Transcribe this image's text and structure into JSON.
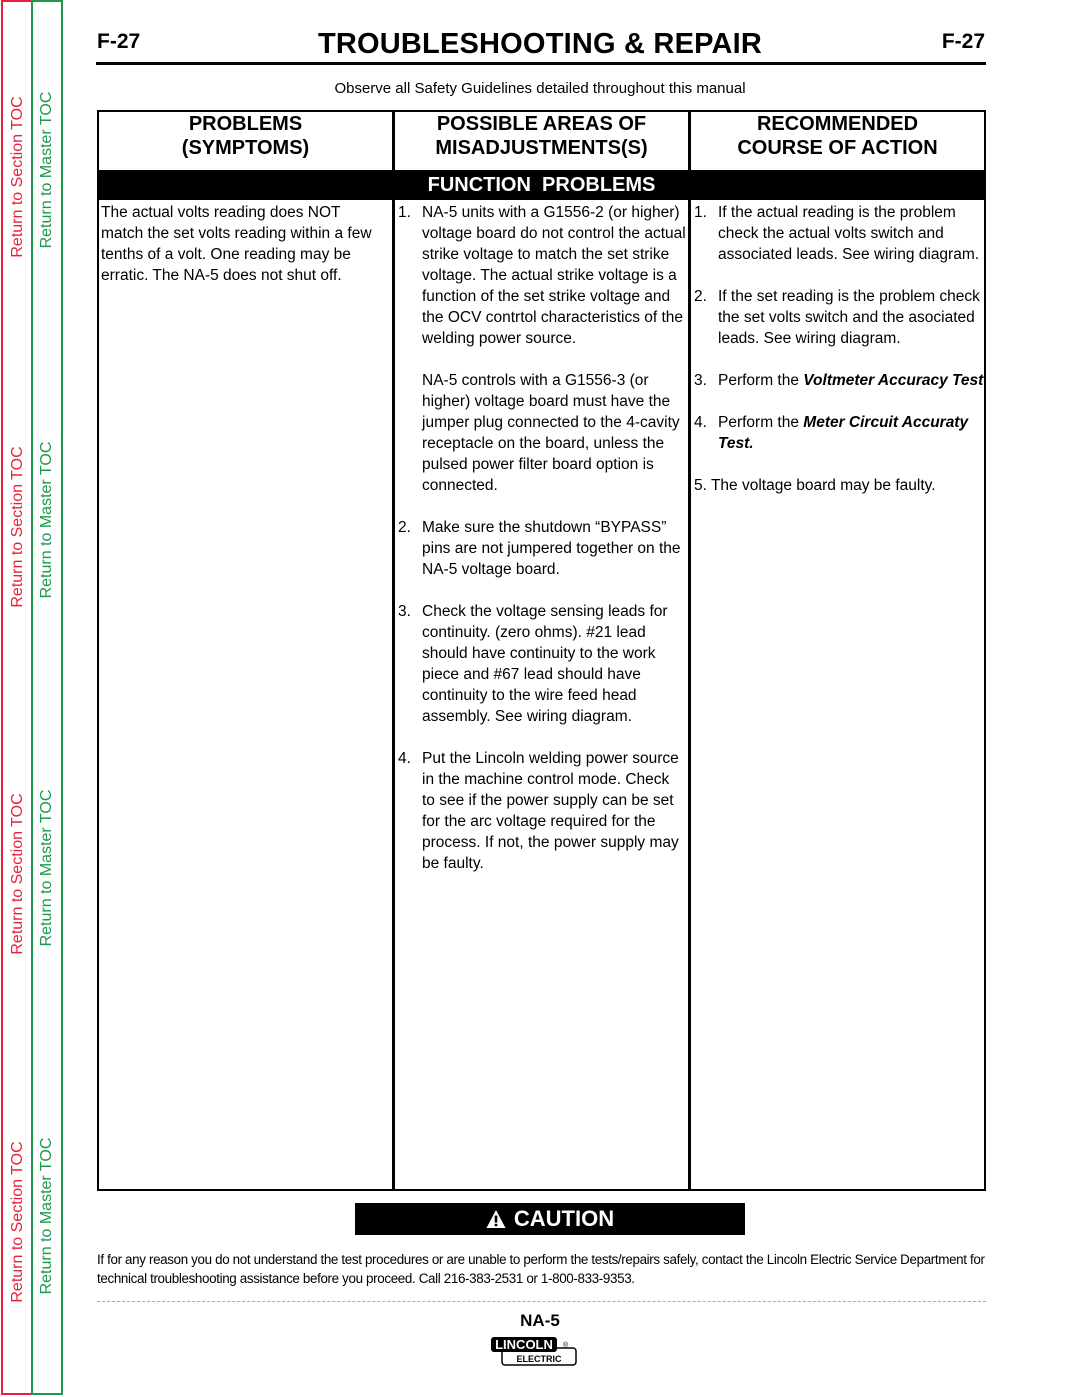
{
  "sidebar": {
    "section_toc_label": "Return to Section TOC",
    "master_toc_label": "Return to Master TOC",
    "section_color": "#e8213a",
    "master_color": "#1b9a4b"
  },
  "header": {
    "page_number": "F-27",
    "title": "TROUBLESHOOTING & REPAIR",
    "safety_note": "Observe all Safety Guidelines detailed throughout this manual"
  },
  "table": {
    "columns": [
      {
        "line1": "PROBLEMS",
        "line2": "(SYMPTOMS)"
      },
      {
        "line1": "POSSIBLE AREAS OF",
        "line2": "MISADJUSTMENTS(S)"
      },
      {
        "line1": "RECOMMENDED",
        "line2": "COURSE OF ACTION"
      }
    ],
    "section_band": "FUNCTION  PROBLEMS",
    "symptom": "The actual volts reading does NOT match the set volts reading within a few tenths of a volt.  One reading may be erratic.  The NA-5 does not shut off.",
    "misadjustments": [
      {
        "num": "1.",
        "text": "NA-5 units with a G1556-2 (or higher) voltage board do not control the actual strike voltage to match the set strike voltage.  The actual strike voltage is a function of the set strike voltage and the OCV contrtol characteristics of the welding power source.",
        "extra": "NA-5 controls with a G1556-3 (or higher) voltage board must have the jumper plug connected to the 4-cavity receptacle on the board, unless the pulsed power filter board option is connected."
      },
      {
        "num": "2.",
        "text": "Make sure the shutdown “BYPASS” pins are not jumpered together on the NA-5 voltage board."
      },
      {
        "num": "3.",
        "text": "Check the voltage sensing leads for continuity. (zero ohms).   #21 lead should have continuity to the work piece and #67 lead should have continuity to the wire feed head assembly.  See wiring diagram."
      },
      {
        "num": "4.",
        "text": "Put the Lincoln welding power source in the machine control mode.  Check to see if the power supply can be set for the arc voltage required for the process.  If not, the power supply may be faulty."
      }
    ],
    "actions": [
      {
        "num": "1.",
        "text": "If the actual reading is the problem check the actual volts switch and associated leads.  See wiring diagram."
      },
      {
        "num": "2.",
        "text": "If the set reading is the problem check the set volts switch and the asociated leads.  See wiring diagram."
      },
      {
        "num": "3.",
        "prefix": "Perform the ",
        "emphasis": "Voltmeter Accuracy Test"
      },
      {
        "num": "4.",
        "prefix": "Perform the ",
        "emphasis": "Meter Circuit Accuraty Test."
      },
      {
        "num": "5.",
        "text": "The voltage board may be faulty."
      }
    ]
  },
  "caution": {
    "label": "CAUTION",
    "icon": "warning-triangle-icon",
    "message": "If for any reason you do not understand the test procedures or are unable to perform the tests/repairs safely, contact the Lincoln Electric Service Department for technical troubleshooting assistance before you proceed. Call 216-383-2531 or 1-800-833-9353."
  },
  "footer": {
    "model": "NA-5",
    "logo_top": "LINCOLN",
    "logo_bottom": "ELECTRIC",
    "logo_mark": "®"
  }
}
